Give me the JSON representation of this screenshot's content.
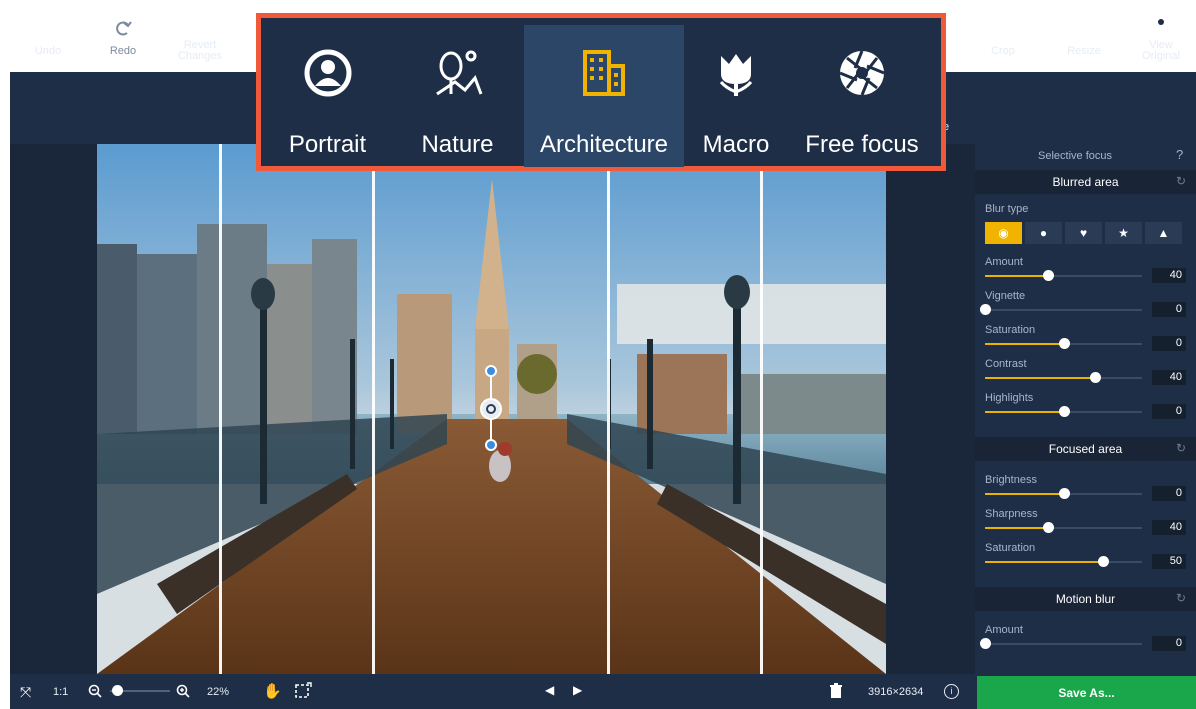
{
  "toolbar": {
    "undo": "Undo",
    "redo": "Redo",
    "revert": "Revert\nChanges",
    "crop": "Crop",
    "resize": "Resize",
    "view_original": "View\nOriginal",
    "partial_label": "e"
  },
  "presets": [
    {
      "label": "Portrait",
      "icon": "portrait-icon",
      "active": false
    },
    {
      "label": "Nature",
      "icon": "nature-icon",
      "active": false
    },
    {
      "label": "Architecture",
      "icon": "architecture-icon",
      "active": true
    },
    {
      "label": "Macro",
      "icon": "macro-icon",
      "active": false
    },
    {
      "label": "Free focus",
      "icon": "free-focus-icon",
      "active": false
    }
  ],
  "panel": {
    "title": "Selective focus",
    "help": "?",
    "blurred_area": {
      "title": "Blurred area",
      "blur_type_label": "Blur type",
      "sliders": [
        {
          "label": "Amount",
          "value": "40",
          "level": 0.4
        },
        {
          "label": "Vignette",
          "value": "0",
          "level": 0.0
        },
        {
          "label": "Saturation",
          "value": "0",
          "level": 0.5
        },
        {
          "label": "Contrast",
          "value": "40",
          "level": 0.7
        },
        {
          "label": "Highlights",
          "value": "0",
          "level": 0.5
        }
      ]
    },
    "focused_area": {
      "title": "Focused area",
      "sliders": [
        {
          "label": "Brightness",
          "value": "0",
          "level": 0.5
        },
        {
          "label": "Sharpness",
          "value": "40",
          "level": 0.4
        },
        {
          "label": "Saturation",
          "value": "50",
          "level": 0.75
        }
      ]
    },
    "motion_blur": {
      "title": "Motion blur",
      "sliders": [
        {
          "label": "Amount",
          "value": "0",
          "level": 0.0
        }
      ]
    }
  },
  "bottom": {
    "one_to_one": "1:1",
    "zoom": "22%",
    "zoom_level": 0.22,
    "dimensions": "3916×2634",
    "save": "Save As..."
  },
  "colors": {
    "accent": "#f0b400",
    "save_green": "#1aa64a",
    "highlight_border": "#f05a3a",
    "panel_bg": "#1f2e47"
  }
}
